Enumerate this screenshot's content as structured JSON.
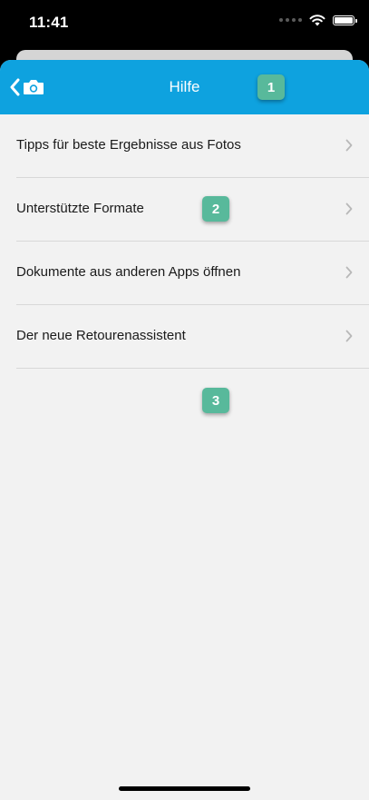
{
  "status_bar": {
    "time": "11:41"
  },
  "nav": {
    "title": "Hilfe",
    "back_icon": "chevron-left-icon",
    "camera_icon": "camera-icon",
    "bar_color": "#0ea2df"
  },
  "list": {
    "items": [
      {
        "label": "Tipps für beste Ergebnisse aus Fotos"
      },
      {
        "label": "Unterstützte Formate"
      },
      {
        "label": "Dokumente aus anderen Apps öffnen"
      },
      {
        "label": "Der neue Retourenassistent"
      }
    ]
  },
  "badges": [
    "1",
    "2",
    "3"
  ],
  "colors": {
    "badge": "#58b99b",
    "background": "#f2f2f2"
  }
}
